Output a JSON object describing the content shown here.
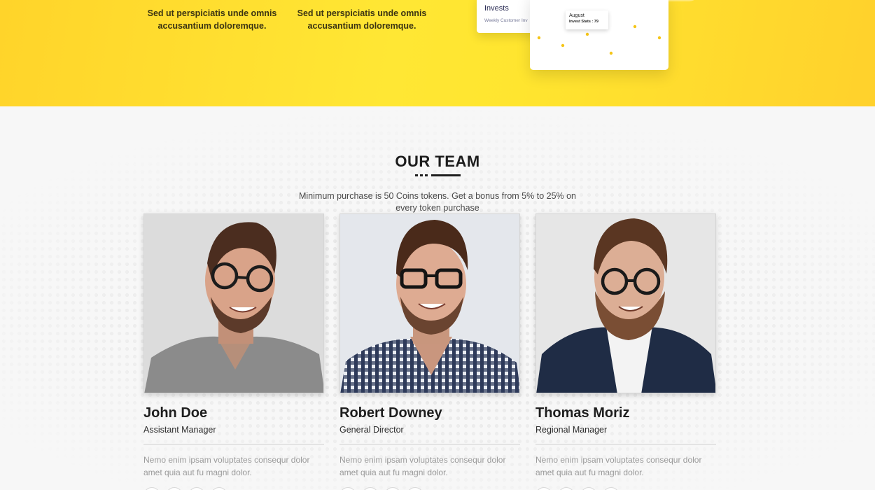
{
  "hero": {
    "features": [
      {
        "text": "Sed ut perspiciatis unde omnis accusantium doloremque."
      },
      {
        "text": "Sed ut perspiciatis unde omnis accusantium doloremque."
      }
    ],
    "invest_card": {
      "title": "Invests",
      "subtitle": "Weekly Customer Inv"
    },
    "stats_card": {
      "tooltip_month": "August",
      "tooltip_value": "Invest Stats : 79"
    }
  },
  "team": {
    "title": "OUR TEAM",
    "intro": "Minimum purchase is 50 Coins tokens. Get a bonus from 5% to 25% on every token purchase",
    "members": [
      {
        "name": "John Doe",
        "role": "Assistant Manager",
        "bio": "Nemo enim ipsam voluptates consequr dolor amet quia aut fu magni dolor."
      },
      {
        "name": "Robert Downey",
        "role": "General Director",
        "bio": "Nemo enim ipsam voluptates consequr dolor amet quia aut fu magni dolor."
      },
      {
        "name": "Thomas Moriz",
        "role": "Regional Manager",
        "bio": "Nemo enim ipsam voluptates consequr dolor amet quia aut fu magni dolor."
      }
    ]
  },
  "colors": {
    "accent": "#FFE234",
    "dot": "#F5C518",
    "heading": "#1D1D1D"
  }
}
